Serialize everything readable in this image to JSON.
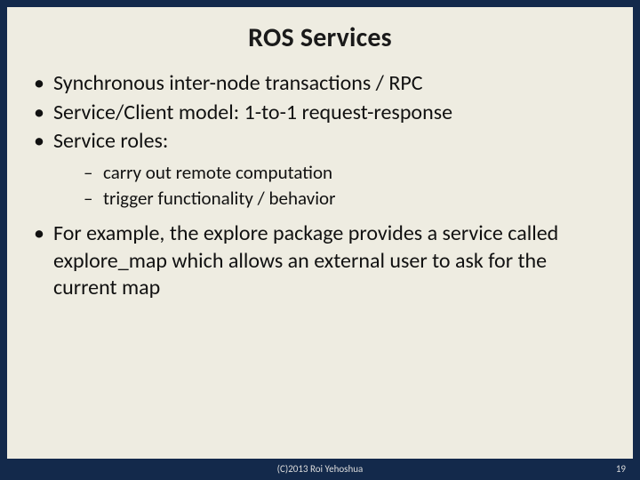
{
  "slide": {
    "title": "ROS Services",
    "bullets": [
      {
        "text": "Synchronous inter-node transactions / RPC"
      },
      {
        "text": "Service/Client model: 1-to-1 request-response"
      },
      {
        "text": "Service roles:",
        "sub": [
          "carry out remote computation",
          "trigger functionality / behavior"
        ]
      },
      {
        "text": "For example, the explore package provides a service called explore_map which allows an external user to ask for the current map"
      }
    ]
  },
  "footer": {
    "copyright": "(C)2013 Roi Yehoshua",
    "page": "19"
  }
}
